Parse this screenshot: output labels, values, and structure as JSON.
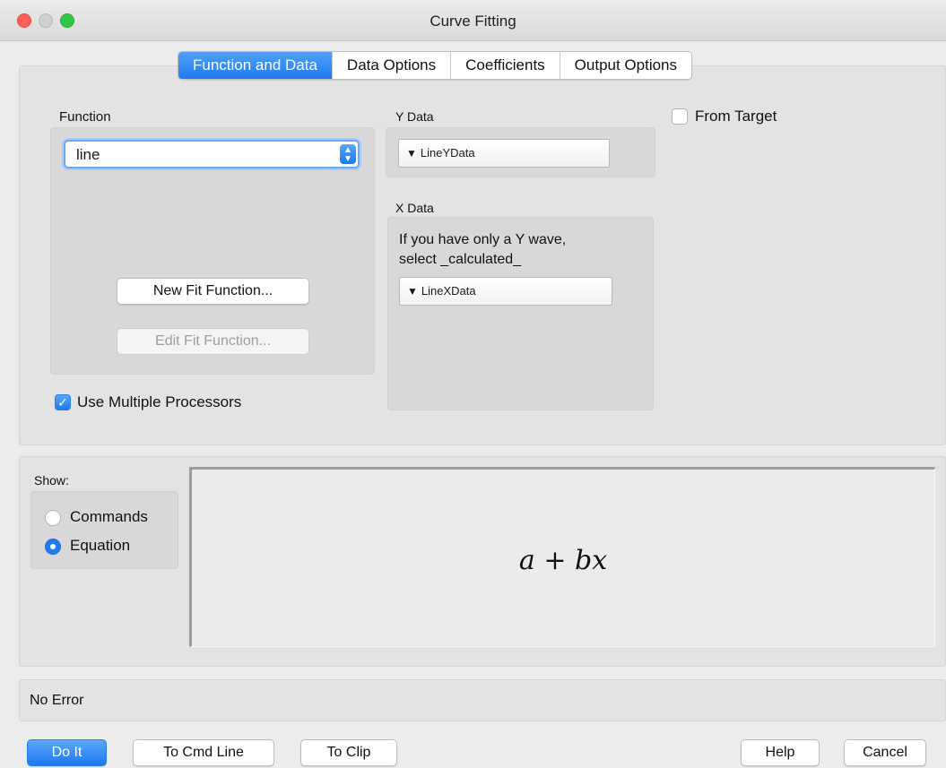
{
  "window": {
    "title": "Curve Fitting"
  },
  "tabs": [
    "Function and Data",
    "Data Options",
    "Coefficients",
    "Output Options"
  ],
  "function_section": {
    "label": "Function",
    "selected": "line",
    "new_button": "New Fit Function...",
    "edit_button": "Edit Fit Function..."
  },
  "ydata": {
    "label": "Y Data",
    "value": "LineYData"
  },
  "xdata": {
    "label": "X Data",
    "hint_line1": "If you have only a Y wave,",
    "hint_line2": "select _calculated_",
    "value": "LineXData"
  },
  "from_target": {
    "label": "From Target",
    "checked": false
  },
  "multiproc": {
    "label": "Use Multiple Processors",
    "checked": true
  },
  "show": {
    "label": "Show:",
    "options": [
      "Commands",
      "Equation"
    ],
    "selected": "Equation"
  },
  "equation": "a + bx",
  "status": "No Error",
  "footer": {
    "do_it": "Do It",
    "to_cmd_line": "To Cmd Line",
    "to_clip": "To Clip",
    "help": "Help",
    "cancel": "Cancel"
  },
  "colors": {
    "accent": "#1f7bf0"
  }
}
